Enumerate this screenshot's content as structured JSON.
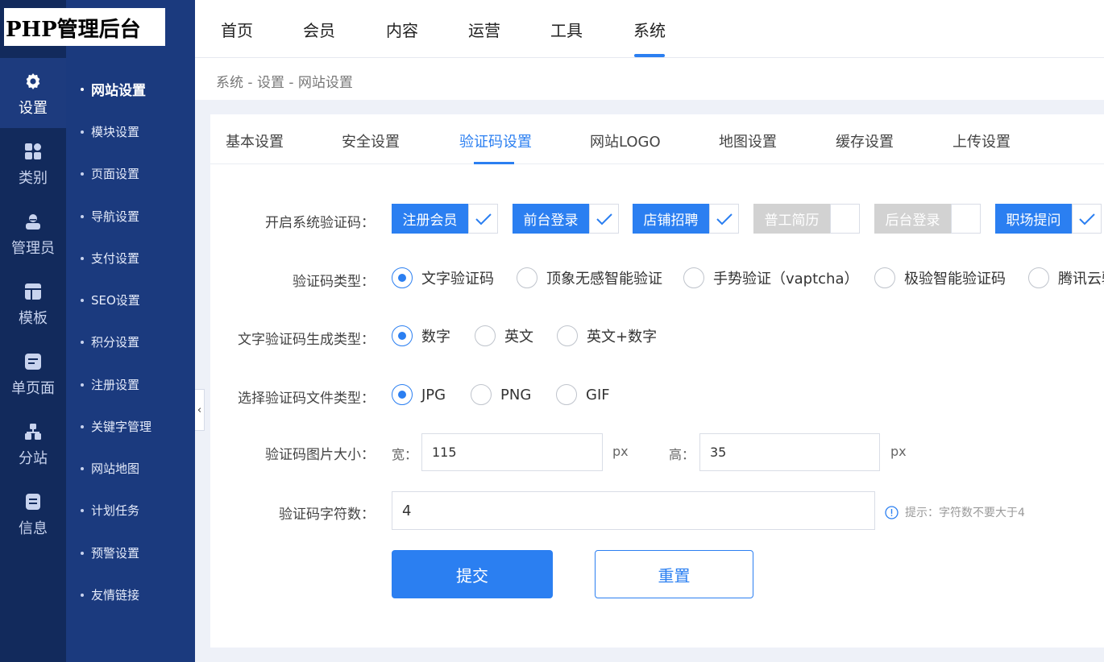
{
  "app": {
    "title": "PHP管理后台"
  },
  "rail": [
    {
      "label": "设置",
      "icon": "gear-icon"
    },
    {
      "label": "类别",
      "icon": "grid-icon"
    },
    {
      "label": "管理员",
      "icon": "user-icon"
    },
    {
      "label": "模板",
      "icon": "template-icon"
    },
    {
      "label": "单页面",
      "icon": "page-icon"
    },
    {
      "label": "分站",
      "icon": "sitemap-icon"
    },
    {
      "label": "信息",
      "icon": "info-icon"
    }
  ],
  "subnav": [
    "网站设置",
    "模块设置",
    "页面设置",
    "导航设置",
    "支付设置",
    "SEO设置",
    "积分设置",
    "注册设置",
    "关键字管理",
    "网站地图",
    "计划任务",
    "预警设置",
    "友情链接"
  ],
  "topnav": [
    "首页",
    "会员",
    "内容",
    "运营",
    "工具",
    "系统"
  ],
  "breadcrumb": "系统 - 设置 - 网站设置",
  "tabs": [
    "基本设置",
    "安全设置",
    "验证码设置",
    "网站LOGO",
    "地图设置",
    "缓存设置",
    "上传设置"
  ],
  "form": {
    "enable": {
      "label": "开启系统验证码：",
      "options": [
        {
          "label": "注册会员",
          "checked": true
        },
        {
          "label": "前台登录",
          "checked": true
        },
        {
          "label": "店铺招聘",
          "checked": true
        },
        {
          "label": "普工简历",
          "checked": false
        },
        {
          "label": "后台登录",
          "checked": false
        },
        {
          "label": "职场提问",
          "checked": true
        }
      ]
    },
    "captcha_type": {
      "label": "验证码类型：",
      "options": [
        "文字验证码",
        "顶象无感智能验证",
        "手势验证（vaptcha）",
        "极验智能验证码",
        "腾讯云验"
      ],
      "selected": "文字验证码"
    },
    "text_type": {
      "label": "文字验证码生成类型：",
      "options": [
        "数字",
        "英文",
        "英文+数字"
      ],
      "selected": "数字"
    },
    "file_type": {
      "label": "选择验证码文件类型：",
      "options": [
        "JPG",
        "PNG",
        "GIF"
      ],
      "selected": "JPG"
    },
    "size": {
      "label": "验证码图片大小：",
      "width_label": "宽：",
      "width": "115",
      "height_label": "高：",
      "height": "35",
      "unit": "px"
    },
    "chars": {
      "label": "验证码字符数：",
      "value": "4",
      "hint": "提示：字符数不要大于4"
    },
    "submit": "提交",
    "reset": "重置"
  },
  "colors": {
    "accent": "#2b7ff1",
    "rail": "#122a5c",
    "subnav": "#1b3a7e"
  }
}
